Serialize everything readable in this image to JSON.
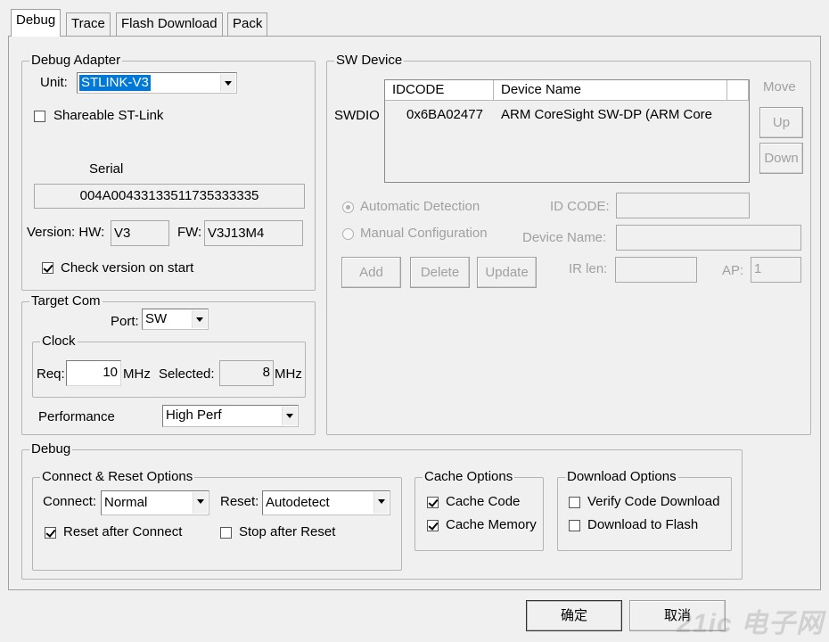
{
  "tabs": [
    {
      "label": "Debug",
      "active": true
    },
    {
      "label": "Trace",
      "active": false
    },
    {
      "label": "Flash Download",
      "active": false
    },
    {
      "label": "Pack",
      "active": false
    }
  ],
  "debug_adapter": {
    "title": "Debug Adapter",
    "unit_label": "Unit:",
    "unit_value": "STLINK-V3",
    "shareable_label": "Shareable ST-Link",
    "shareable_checked": false,
    "serial_label": "Serial",
    "serial_value": "004A00433133511735333335",
    "version_hw_label": "Version: HW:",
    "hw_value": "V3",
    "fw_label": "FW:",
    "fw_value": "V3J13M4",
    "check_version_label": "Check version on start",
    "check_version_checked": true
  },
  "target_com": {
    "title": "Target Com",
    "port_label": "Port:",
    "port_value": "SW",
    "clock_title": "Clock",
    "req_label": "Req:",
    "req_value": "10",
    "req_unit": "MHz",
    "selected_label": "Selected:",
    "selected_value": "8",
    "selected_unit": "MHz",
    "performance_label": "Performance",
    "performance_value": "High Perf"
  },
  "sw_device": {
    "title": "SW Device",
    "columns": [
      "IDCODE",
      "Device Name"
    ],
    "row_label": "SWDIO",
    "rows": [
      {
        "idcode": "0x6BA02477",
        "device_name": "ARM CoreSight SW-DP (ARM Core"
      }
    ],
    "move_label": "Move",
    "up_label": "Up",
    "down_label": "Down",
    "auto_detection_label": "Automatic Detection",
    "manual_config_label": "Manual Configuration",
    "id_code_label": "ID CODE:",
    "device_name_label": "Device Name:",
    "add_label": "Add",
    "delete_label": "Delete",
    "update_label": "Update",
    "ir_len_label": "IR len:",
    "ap_label": "AP:",
    "ap_value": "1"
  },
  "debug": {
    "title": "Debug",
    "connect_reset_title": "Connect & Reset Options",
    "connect_label": "Connect:",
    "connect_value": "Normal",
    "reset_label": "Reset:",
    "reset_value": "Autodetect",
    "reset_after_connect_label": "Reset after Connect",
    "reset_after_connect_checked": true,
    "stop_after_reset_label": "Stop after Reset",
    "stop_after_reset_checked": false,
    "cache_title": "Cache Options",
    "cache_code_label": "Cache Code",
    "cache_memory_label": "Cache Memory",
    "download_title": "Download Options",
    "verify_label": "Verify Code Download",
    "download_flash_label": "Download to Flash"
  },
  "footer": {
    "ok_label": "确定",
    "cancel_label": "取消"
  },
  "watermark": "21ic 电子网"
}
